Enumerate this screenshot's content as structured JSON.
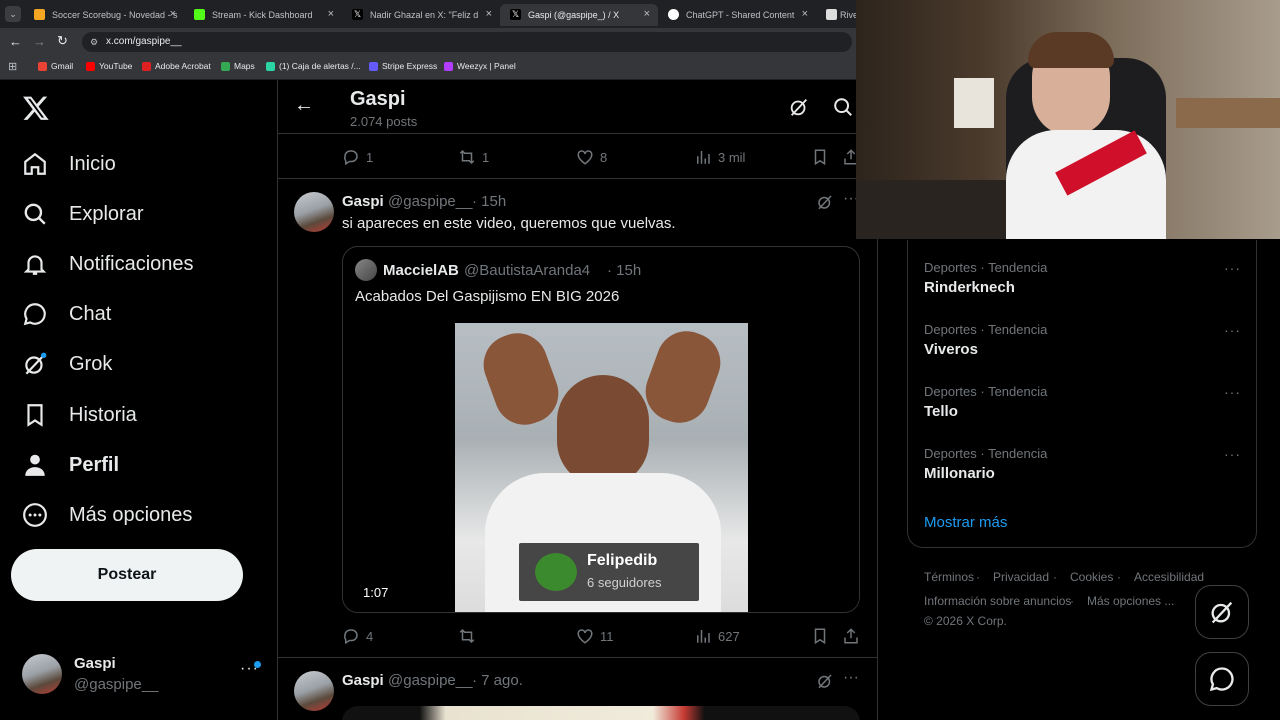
{
  "browser": {
    "tabs": [
      {
        "title": "Soccer Scorebug - Novedad - s",
        "fav": "#f5a623",
        "active": false
      },
      {
        "title": "Stream - Kick Dashboard",
        "fav": "#53fc18",
        "active": false
      },
      {
        "title": "Nadir Ghazal en X: \"Feliz día de",
        "fav": "#ffffff",
        "active": false
      },
      {
        "title": "Gaspi (@gaspipe_) / X",
        "fav": "#ffffff",
        "active": true
      },
      {
        "title": "ChatGPT - Shared Content",
        "fav": "#ffffff",
        "active": false
      },
      {
        "title": "Rive",
        "fav": "#ffffff",
        "active": false
      }
    ],
    "url": "x.com/gaspipe__",
    "bookmarks": [
      {
        "label": "Gmail",
        "color": "#ea4335"
      },
      {
        "label": "YouTube",
        "color": "#ff0000"
      },
      {
        "label": "Adobe Acrobat",
        "color": "#e02020"
      },
      {
        "label": "Maps",
        "color": "#34a853"
      },
      {
        "label": "(1) Caja de alertas /...",
        "color": "#2ad4a4"
      },
      {
        "label": "Stripe Express",
        "color": "#635bff"
      },
      {
        "label": "Weezyx | Panel",
        "color": "#b23cff"
      }
    ]
  },
  "nav": {
    "items": [
      {
        "label": "Inicio",
        "icon": "home-icon"
      },
      {
        "label": "Explorar",
        "icon": "search-icon"
      },
      {
        "label": "Notificaciones",
        "icon": "bell-icon"
      },
      {
        "label": "Chat",
        "icon": "chat-icon"
      },
      {
        "label": "Grok",
        "icon": "grok-icon"
      },
      {
        "label": "Historia",
        "icon": "bookmark-icon"
      },
      {
        "label": "Perfil",
        "icon": "person-icon"
      },
      {
        "label": "Más opciones",
        "icon": "more-circle-icon"
      }
    ],
    "post_label": "Postear",
    "account": {
      "name": "Gaspi",
      "handle": "@gaspipe__"
    }
  },
  "header": {
    "title": "Gaspi",
    "posts": "2.074 posts"
  },
  "top_actions": {
    "replies": "1",
    "reposts": "1",
    "likes": "8",
    "views": "3 mil"
  },
  "tweet": {
    "name": "Gaspi",
    "handle": "@gaspipe__",
    "time": "· 15h",
    "text": "si apareces en este video, queremos que vuelvas.",
    "quote": {
      "name": "MaccielAB",
      "handle": "@BautistaAranda4",
      "time": "· 15h",
      "text": "Acabados Del Gaspijismo EN BIG 2026",
      "duration": "1:07",
      "overlay_name": "Felipedib",
      "overlay_sub": "6 seguidores"
    },
    "actions": {
      "replies": "4",
      "reposts": "",
      "likes": "11",
      "views": "627"
    }
  },
  "next_tweet": {
    "name": "Gaspi",
    "handle": "@gaspipe__",
    "time": "· 7 ago."
  },
  "trends": [
    {
      "category": "Deportes · Tendencia",
      "name": "Rinderknech"
    },
    {
      "category": "Deportes · Tendencia",
      "name": "Viveros"
    },
    {
      "category": "Deportes · Tendencia",
      "name": "Tello"
    },
    {
      "category": "Deportes · Tendencia",
      "name": "Millonario"
    }
  ],
  "show_more": "Mostrar más",
  "footer": {
    "terms": "Términos",
    "privacy": "Privacidad",
    "cookies": "Cookies",
    "accessibility": "Accesibilidad",
    "ads": "Información sobre anuncios",
    "more": "Más opciones ...",
    "copyright": "© 2026 X Corp."
  },
  "colors": {
    "accent": "#1d9bf0",
    "muted": "#71767b",
    "border": "#2f3336"
  }
}
